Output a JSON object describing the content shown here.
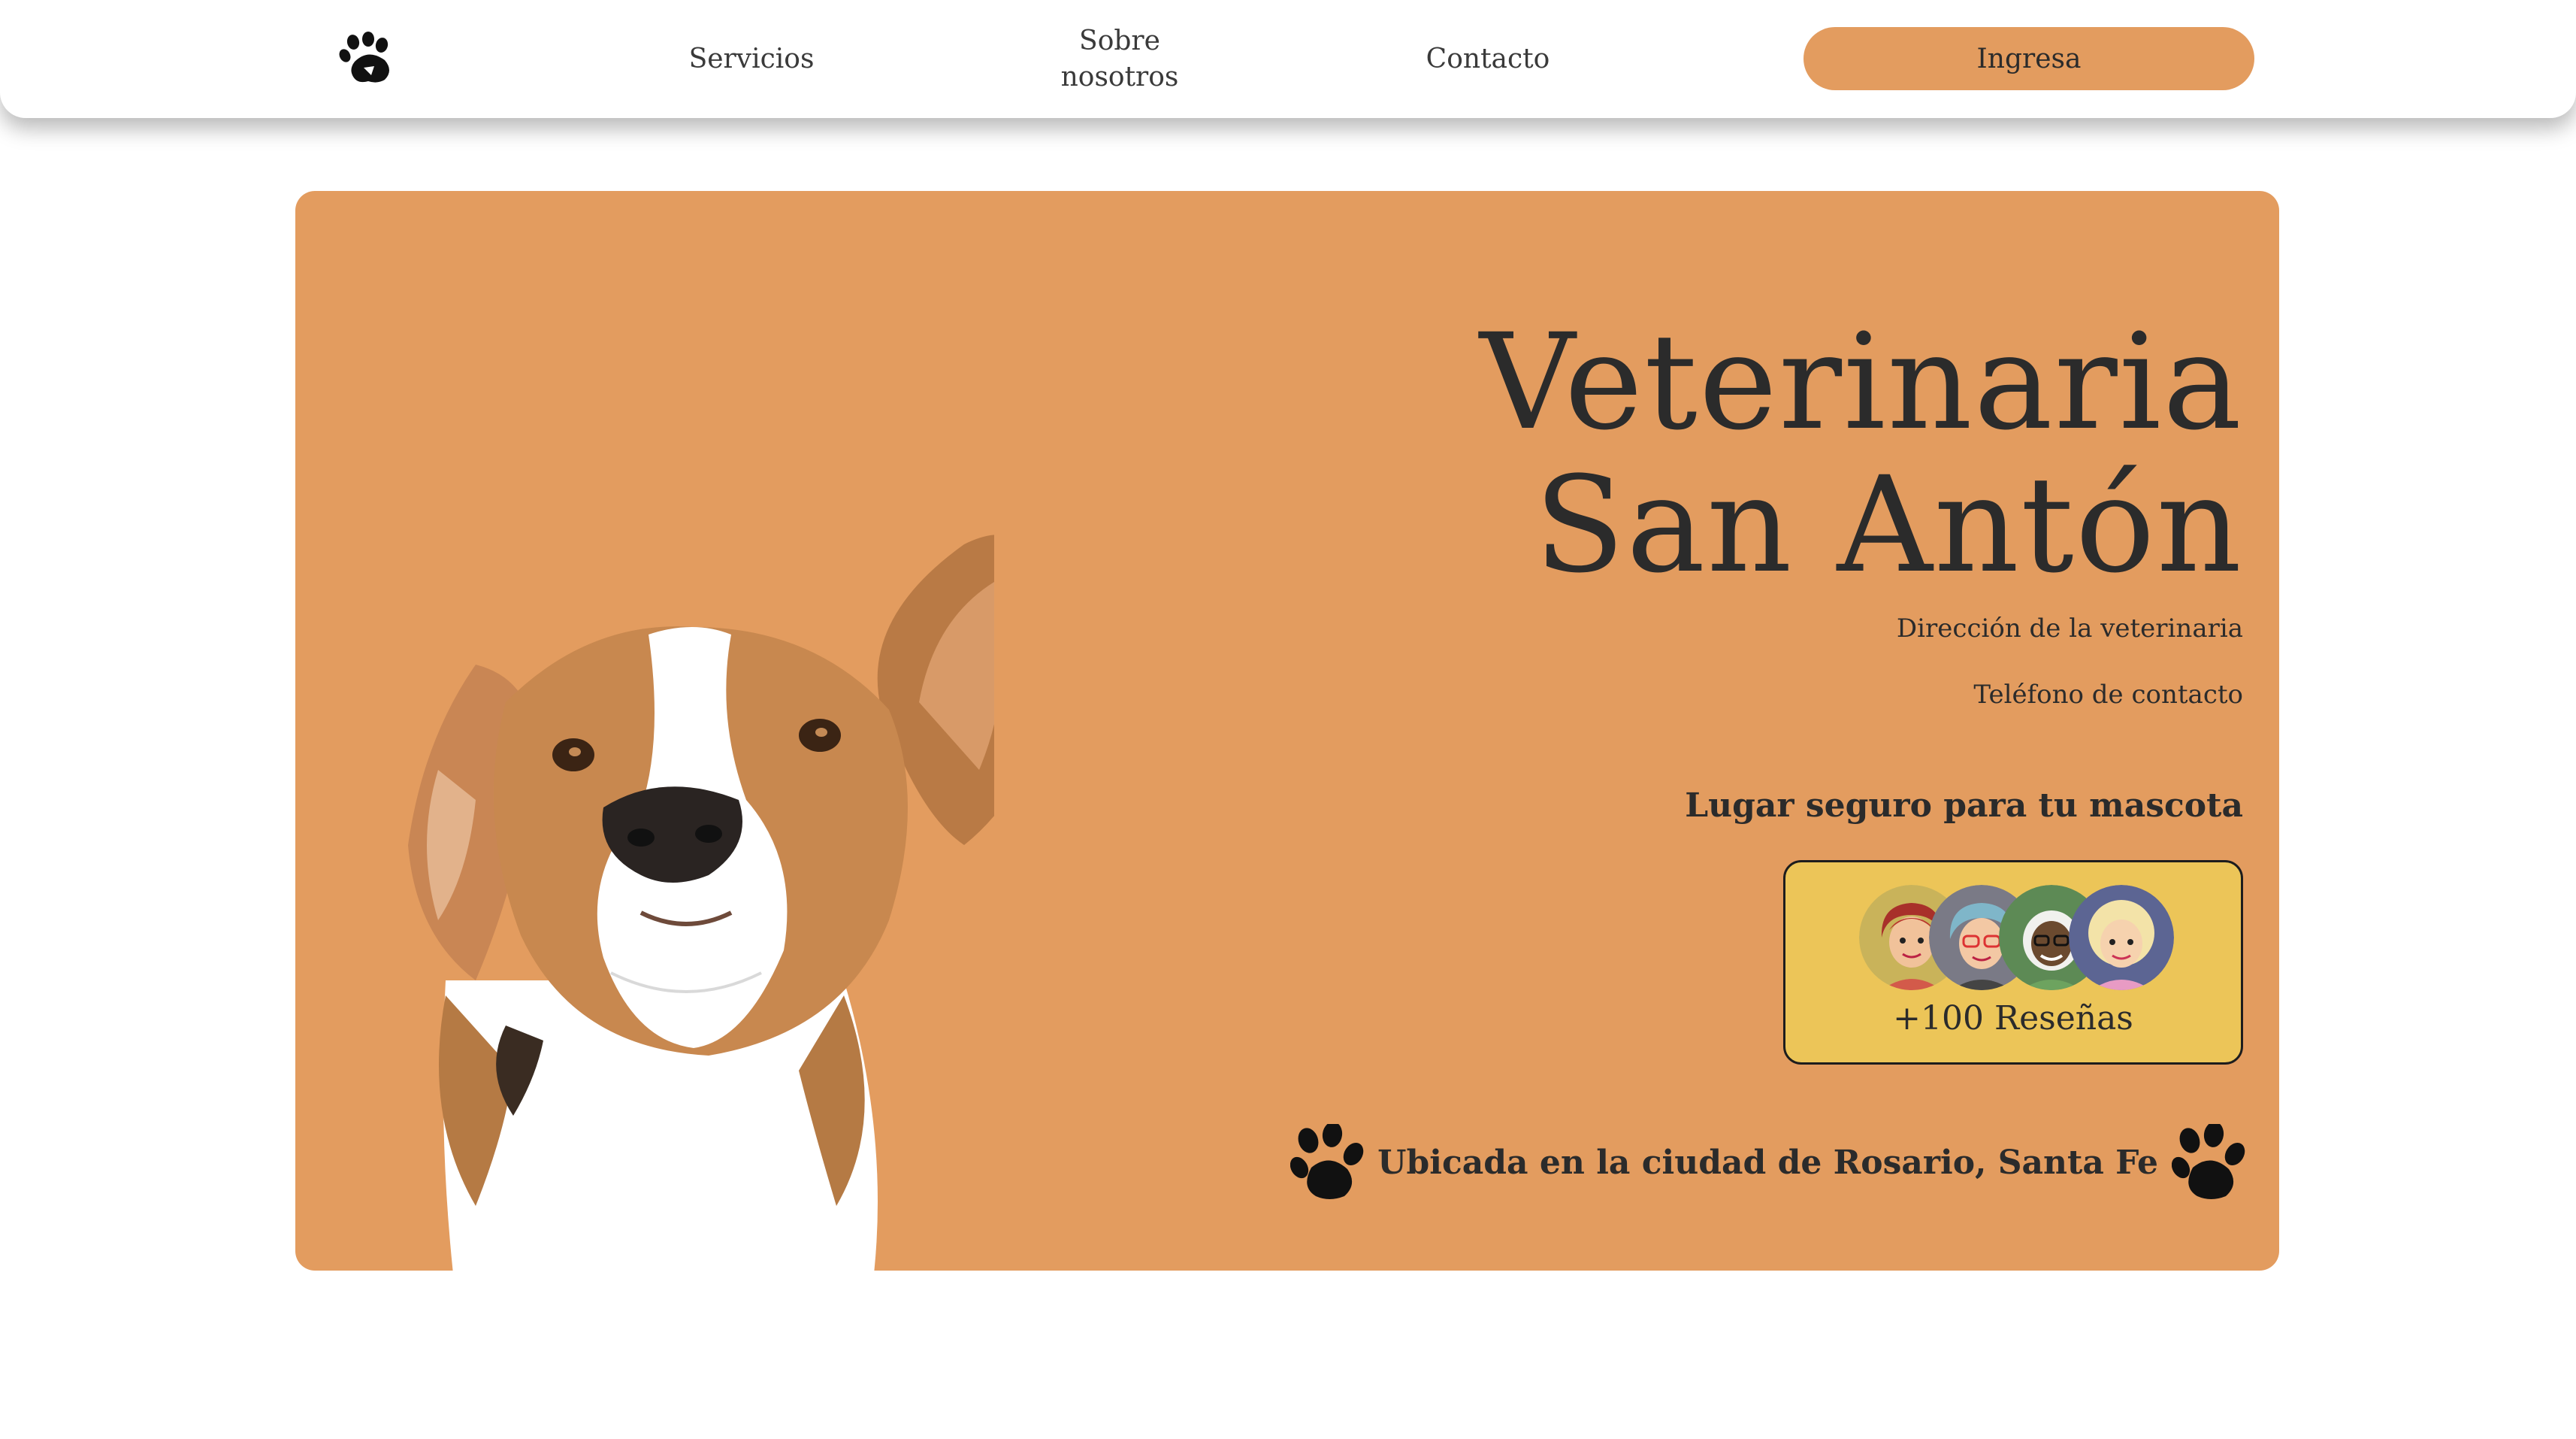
{
  "nav": {
    "logo_icon": "paw-icon",
    "links": [
      "Servicios",
      "Sobre nosotros",
      "Contacto"
    ],
    "sobre_line1": "Sobre",
    "sobre_line2": "nosotros",
    "login_label": "Ingresa"
  },
  "hero": {
    "title_line1": "Veterinaria",
    "title_line2": "San Antón",
    "address": "Dirección de la veterinaria",
    "phone": "Teléfono de contacto",
    "tagline": "Lugar seguro para tu mascota",
    "reviews_label": "+100 Reseñas",
    "location": "Ubicada en la ciudad de Rosario, Santa Fe"
  },
  "colors": {
    "accent": "#e39c5f",
    "reviews_card": "#ecc558",
    "text": "#2b2b2b",
    "background": "#ffffff"
  }
}
